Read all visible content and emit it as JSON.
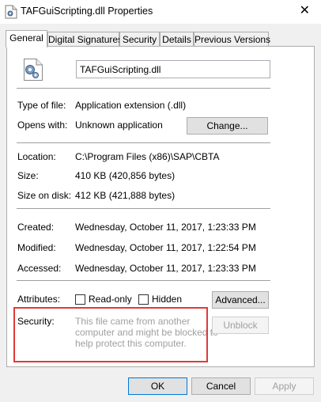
{
  "window": {
    "title": "TAFGuiScripting.dll Properties",
    "close_glyph": "✕"
  },
  "tabs": [
    {
      "label": "General",
      "active": true
    },
    {
      "label": "Digital Signatures",
      "active": false
    },
    {
      "label": "Security",
      "active": false
    },
    {
      "label": "Details",
      "active": false
    },
    {
      "label": "Previous Versions",
      "active": false
    }
  ],
  "general": {
    "file_name": "TAFGuiScripting.dll",
    "type_label": "Type of file:",
    "type_value": "Application extension (.dll)",
    "opens_label": "Opens with:",
    "opens_value": "Unknown application",
    "change_button": "Change...",
    "location_label": "Location:",
    "location_value": "C:\\Program Files (x86)\\SAP\\CBTA",
    "size_label": "Size:",
    "size_value": "410 KB (420,856 bytes)",
    "size_on_disk_label": "Size on disk:",
    "size_on_disk_value": "412 KB (421,888 bytes)",
    "created_label": "Created:",
    "created_value": "Wednesday, October 11, 2017, 1:23:33 PM",
    "modified_label": "Modified:",
    "modified_value": "Wednesday, October 11, 2017, 1:22:54 PM",
    "accessed_label": "Accessed:",
    "accessed_value": "Wednesday, October 11, 2017, 1:23:33 PM",
    "attributes_label": "Attributes:",
    "readonly_label": "Read-only",
    "hidden_label": "Hidden",
    "advanced_button": "Advanced...",
    "security_label": "Security:",
    "security_line1": "This file came from another",
    "security_line2": "computer and might be blocked to",
    "security_line3": "help protect this computer.",
    "unblock_button": "Unblock"
  },
  "footer": {
    "ok_button": "OK",
    "cancel_button": "Cancel",
    "apply_button": "Apply"
  },
  "colors": {
    "highlight_border": "#e03a3a",
    "disabled_text": "#a0a0a0"
  }
}
